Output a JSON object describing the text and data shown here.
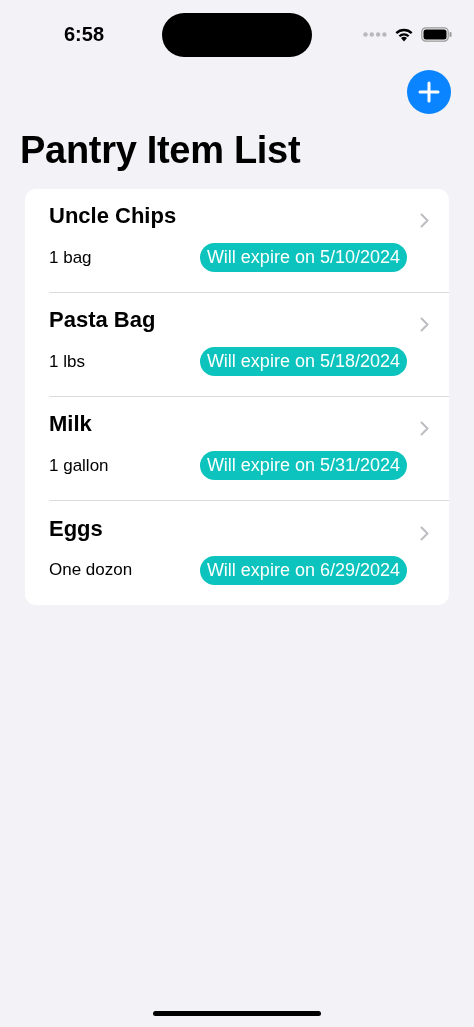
{
  "status_bar": {
    "time": "6:58"
  },
  "title": "Pantry Item List",
  "items": [
    {
      "name": "Uncle Chips",
      "quantity": "1 bag",
      "expiry": "Will expire on 5/10/2024"
    },
    {
      "name": "Pasta Bag",
      "quantity": "1 lbs",
      "expiry": "Will expire on 5/18/2024"
    },
    {
      "name": "Milk",
      "quantity": "1 gallon",
      "expiry": "Will expire on 5/31/2024"
    },
    {
      "name": "Eggs",
      "quantity": "One dozon",
      "expiry": "Will expire on 6/29/2024"
    }
  ]
}
